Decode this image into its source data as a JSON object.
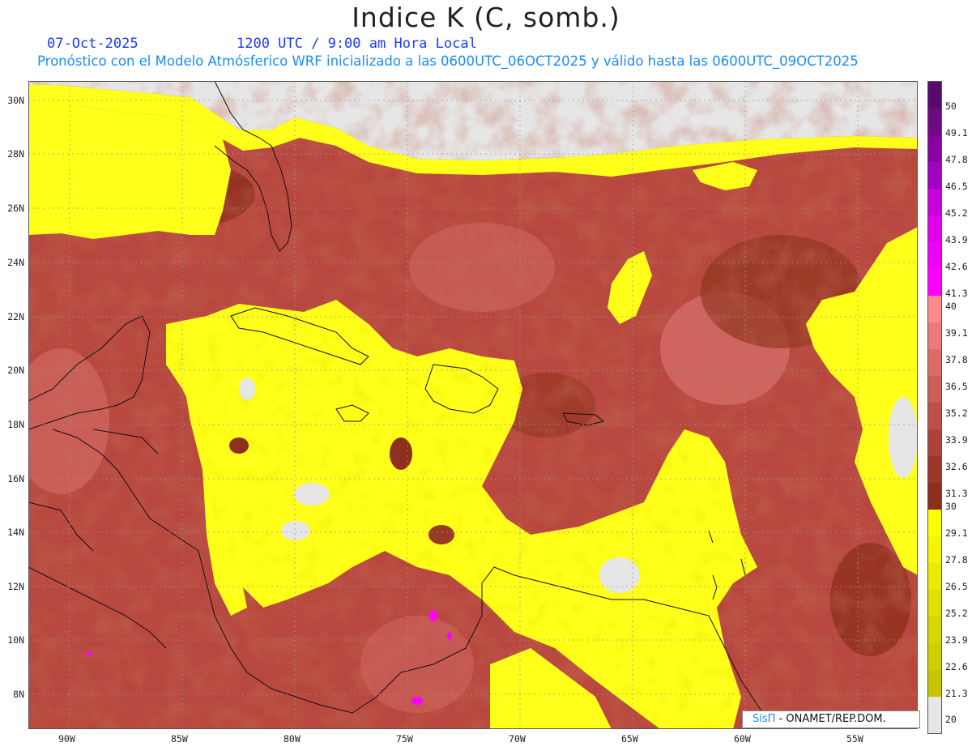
{
  "title": "Indice K (C, somb.)",
  "date": "07-Oct-2025",
  "time": "1200 UTC / 9:00 am Hora Local",
  "forecast_line": "Pronóstico con el Modelo Atmósferico WRF inicializado a las 0600UTC_06OCT2025 y válido hasta las  0600UTC_09OCT2025",
  "lat_labels": [
    "30N",
    "28N",
    "26N",
    "24N",
    "22N",
    "20N",
    "18N",
    "16N",
    "14N",
    "12N",
    "10N",
    "8N"
  ],
  "lon_labels": [
    "90W",
    "85W",
    "80W",
    "75W",
    "70W",
    "65W",
    "60W",
    "55W"
  ],
  "colorbar": {
    "labels": [
      "50",
      "49.1",
      "47.8",
      "46.5",
      "45.2",
      "43.9",
      "42.6",
      "41.3",
      "40",
      "39.1",
      "37.8",
      "36.5",
      "35.2",
      "33.9",
      "32.6",
      "31.3",
      "30",
      "29.1",
      "27.8",
      "26.5",
      "25.2",
      "23.9",
      "22.6",
      "21.3",
      "20"
    ],
    "colors": {
      "purple_dark": "#5a0a6e",
      "magenta": "#ff00ff",
      "pink": "#ff8a8a",
      "red_brown": "#c1504a",
      "dark_brown": "#8b2e1a",
      "yellow": "#ffff00",
      "olive": "#c7c400",
      "grey": "#e6e6e6"
    }
  },
  "credit": {
    "brand": "SisΠ",
    "text": " - ONAMET/REP.DOM."
  }
}
